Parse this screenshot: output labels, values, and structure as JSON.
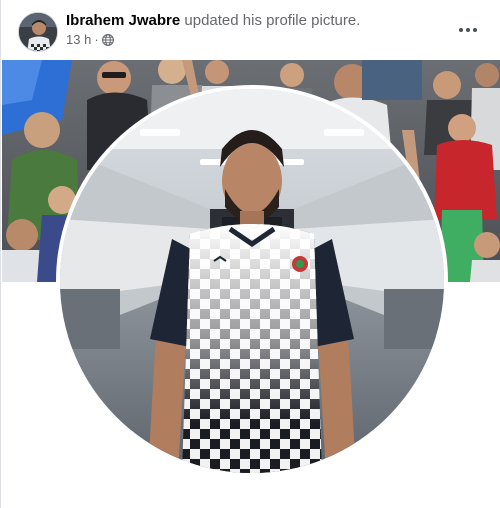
{
  "post": {
    "author": "Ibrahem Jwabre",
    "action": "updated his profile picture.",
    "time": "13 h",
    "separator": "·",
    "privacy_icon": "globe-icon",
    "menu_icon": "more-options-icon"
  },
  "images": {
    "cover": "cover-photo-crowd",
    "profile": "profile-picture-footballer"
  }
}
